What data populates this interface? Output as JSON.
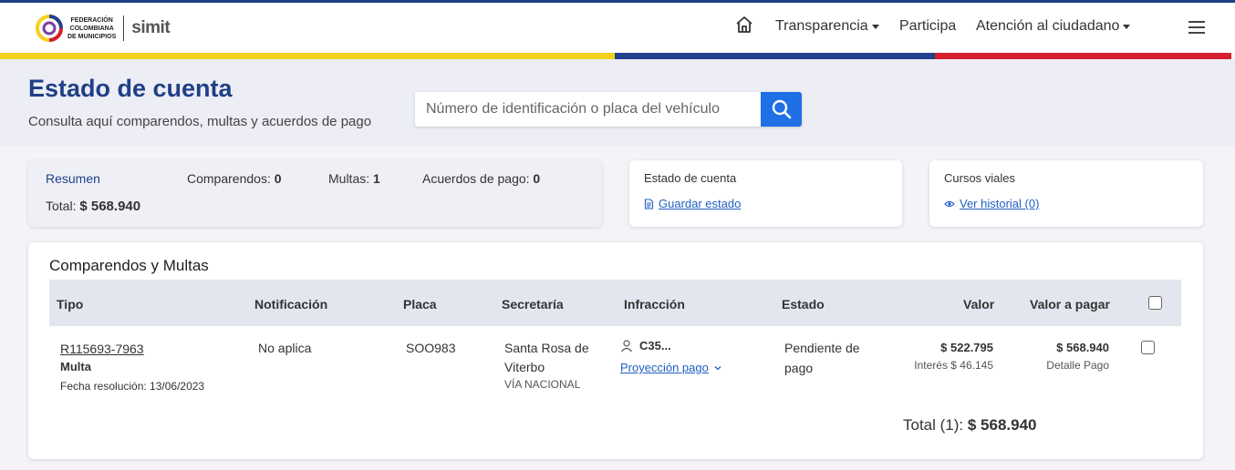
{
  "header": {
    "logo": {
      "org_line1": "FEDERACIÓN",
      "org_line2": "COLOMBIANA",
      "org_line3": "DE MUNICIPIOS",
      "brand": "simit"
    },
    "nav": [
      {
        "label": "Transparencia",
        "dropdown": true
      },
      {
        "label": "Participa",
        "dropdown": false
      },
      {
        "label": "Atención al ciudadano",
        "dropdown": true
      }
    ],
    "flag_colors": [
      "#f2d21b",
      "#23408e",
      "#d61f2c"
    ]
  },
  "page": {
    "title": "Estado de cuenta",
    "subtitle": "Consulta aquí comparendos, multas y acuerdos de pago",
    "search_placeholder": "Número de identificación o placa del vehículo"
  },
  "summary": {
    "heading": "Resumen",
    "total_label": "Total:",
    "total_value": "$ 568.940",
    "comparendos_label": "Comparendos:",
    "comparendos_value": "0",
    "multas_label": "Multas:",
    "multas_value": "1",
    "acuerdos_label": "Acuerdos de pago:",
    "acuerdos_value": "0"
  },
  "estado_card": {
    "title": "Estado de cuenta",
    "link": "Guardar estado"
  },
  "cursos_card": {
    "title": "Cursos viales",
    "link": "Ver historial (0)"
  },
  "table": {
    "title": "Comparendos y Multas",
    "headers": [
      "Tipo",
      "Notificación",
      "Placa",
      "Secretaría",
      "Infracción",
      "Estado",
      "Valor",
      "Valor a pagar"
    ],
    "rows": [
      {
        "id": "R115693-7963",
        "tipo": "Multa",
        "fecha": "Fecha resolución: 13/06/2023",
        "notificacion": "No aplica",
        "placa": "SOO983",
        "secretaria_1": "Santa Rosa de",
        "secretaria_2": "Viterbo",
        "via": "VÍA NACIONAL",
        "infraccion": "C35...",
        "proyeccion": "Proyección pago",
        "estado_1": "Pendiente de",
        "estado_2": "pago",
        "valor": "$ 522.795",
        "interes": "Interés $ 46.145",
        "valor_pagar": "$ 568.940",
        "detalle": "Detalle Pago"
      }
    ],
    "total_label": "Total (1):",
    "total_value": "$ 568.940"
  }
}
